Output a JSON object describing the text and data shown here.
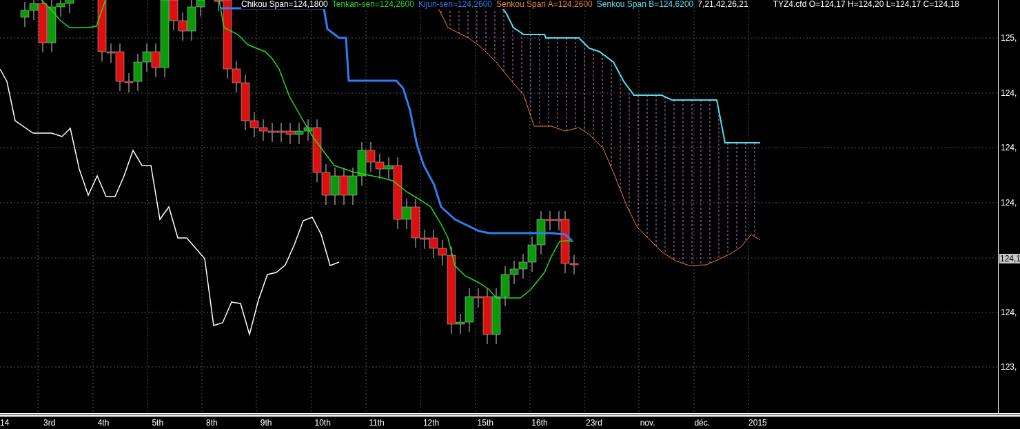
{
  "legend": [
    {
      "text": "Chikou Span=124,1800",
      "color": "#ffffff"
    },
    {
      "text": "Tenkan-sen=124,2600",
      "color": "#22dd22"
    },
    {
      "text": "Kijun-sen=124,2600",
      "color": "#2f7ff0"
    },
    {
      "text": "Senkou Span A=124,2600",
      "color": "#e8843a"
    },
    {
      "text": "Senkou Span B=124,6200",
      "color": "#55e0f0"
    },
    {
      "text": "7,21,42,26,21",
      "color": "#ffffff"
    }
  ],
  "instrument": "TYZ4.cfd O=124,17 H=124,20 L=124,17 C=124,18",
  "y_axis": {
    "labels": [
      "125,",
      "124,",
      "124,",
      "124,",
      "124,",
      "123,"
    ]
  },
  "price_tag": "124,1",
  "x_axis": {
    "labels": [
      "14",
      "3rd",
      "4th",
      "5th",
      "8th",
      "9th",
      "10th",
      "11th",
      "12th",
      "15th",
      "16th",
      "23rd",
      "nov.",
      "déc.",
      "2015"
    ]
  }
}
